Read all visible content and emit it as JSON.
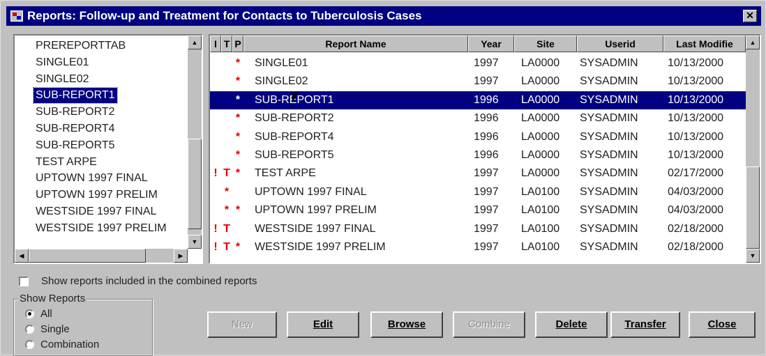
{
  "window": {
    "title": "Reports: Follow-up and Treatment for Contacts to Tuberculosis Cases",
    "close_glyph": "✕",
    "icon": "reports-app-icon"
  },
  "left_list": {
    "items": [
      {
        "label": "PREREPORTTAB"
      },
      {
        "label": "SINGLE01"
      },
      {
        "label": "SINGLE02"
      },
      {
        "label": "SUB-REPORT1",
        "selected": true
      },
      {
        "label": "SUB-REPORT2"
      },
      {
        "label": "SUB-REPORT4"
      },
      {
        "label": "SUB-REPORT5"
      },
      {
        "label": "TEST ARPE"
      },
      {
        "label": "UPTOWN 1997 FINAL"
      },
      {
        "label": "UPTOWN 1997 PRELIM"
      },
      {
        "label": "WESTSIDE 1997 FINAL"
      },
      {
        "label": "WESTSIDE 1997 PRELIM"
      }
    ]
  },
  "grid": {
    "headers": {
      "i": "I",
      "t": "T",
      "p": "P",
      "name": "Report Name",
      "year": "Year",
      "site": "Site",
      "userid": "Userid",
      "modified": "Last Modifie"
    },
    "rows": [
      {
        "i": "",
        "t": "",
        "p": "*",
        "name": "SINGLE01",
        "year": "1997",
        "site": "LA0000",
        "userid": "SYSADMIN",
        "modified": "10/13/2000"
      },
      {
        "i": "",
        "t": "",
        "p": "*",
        "name": "SINGLE02",
        "year": "1997",
        "site": "LA0000",
        "userid": "SYSADMIN",
        "modified": "10/13/2000"
      },
      {
        "i": "",
        "t": "",
        "p": "*",
        "name": "SUB-REPORT1",
        "year": "1996",
        "site": "LA0000",
        "userid": "SYSADMIN",
        "modified": "10/13/2000",
        "selected": true
      },
      {
        "i": "",
        "t": "",
        "p": "*",
        "name": "SUB-REPORT2",
        "year": "1996",
        "site": "LA0000",
        "userid": "SYSADMIN",
        "modified": "10/13/2000"
      },
      {
        "i": "",
        "t": "",
        "p": "*",
        "name": "SUB-REPORT4",
        "year": "1996",
        "site": "LA0000",
        "userid": "SYSADMIN",
        "modified": "10/13/2000"
      },
      {
        "i": "",
        "t": "",
        "p": "*",
        "name": "SUB-REPORT5",
        "year": "1996",
        "site": "LA0000",
        "userid": "SYSADMIN",
        "modified": "10/13/2000"
      },
      {
        "i": "!",
        "t": "T",
        "p": "*",
        "name": "TEST ARPE",
        "year": "1997",
        "site": "LA0000",
        "userid": "SYSADMIN",
        "modified": "02/17/2000"
      },
      {
        "i": "",
        "t": "*",
        "p": "",
        "name": "UPTOWN 1997 FINAL",
        "year": "1997",
        "site": "LA0100",
        "userid": "SYSADMIN",
        "modified": "04/03/2000"
      },
      {
        "i": "",
        "t": "*",
        "p": "*",
        "name": "UPTOWN 1997 PRELIM",
        "year": "1997",
        "site": "LA0100",
        "userid": "SYSADMIN",
        "modified": "04/03/2000"
      },
      {
        "i": "!",
        "t": "T",
        "p": "",
        "name": "WESTSIDE 1997 FINAL",
        "year": "1997",
        "site": "LA0100",
        "userid": "SYSADMIN",
        "modified": "02/18/2000"
      },
      {
        "i": "!",
        "t": "T",
        "p": "*",
        "name": "WESTSIDE 1997 PRELIM",
        "year": "1997",
        "site": "LA0100",
        "userid": "SYSADMIN",
        "modified": "02/18/2000"
      }
    ]
  },
  "options": {
    "show_combined_label": "Show reports included in the combined reports",
    "show_combined_checked": false
  },
  "show_reports": {
    "label": "Show Reports",
    "options": [
      {
        "label": "All",
        "selected": true
      },
      {
        "label": "Single",
        "selected": false
      },
      {
        "label": "Combination",
        "selected": false
      }
    ]
  },
  "buttons": {
    "new": "New",
    "edit": "Edit",
    "browse": "Browse",
    "combine": "Combine",
    "delete": "Delete",
    "transfer": "Transfer",
    "close": "Close"
  },
  "colors": {
    "titlebar": "#000080",
    "selection": "#000080",
    "flag": "#e00000",
    "face": "#c0c0c0"
  }
}
